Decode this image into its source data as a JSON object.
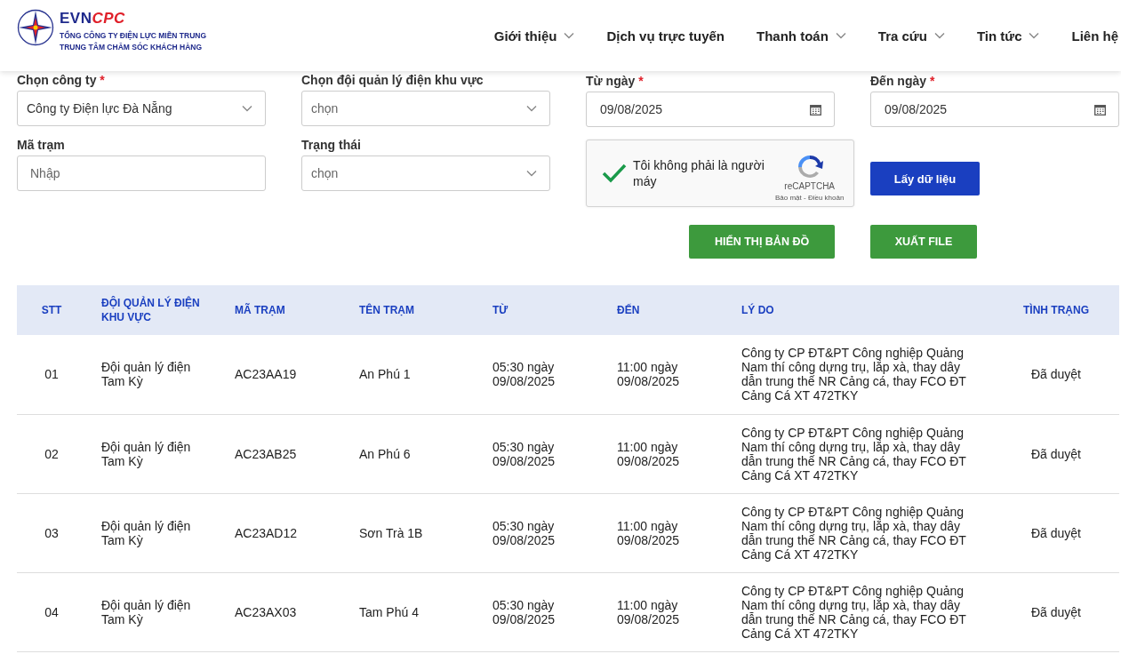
{
  "brand": {
    "logo_main": "EVN",
    "logo_accent": "CPC",
    "line1": "TỔNG CÔNG TY ĐIỆN LỰC MIỀN TRUNG",
    "line2": "TRUNG TÂM CHĂM SÓC KHÁCH HÀNG"
  },
  "nav": [
    {
      "label": "Giới thiệu",
      "dropdown": true
    },
    {
      "label": "Dịch vụ trực tuyến",
      "dropdown": false
    },
    {
      "label": "Thanh toán",
      "dropdown": true
    },
    {
      "label": "Tra cứu",
      "dropdown": true
    },
    {
      "label": "Tin tức",
      "dropdown": true
    },
    {
      "label": "Liên hệ",
      "dropdown": false
    }
  ],
  "required_mark": "*",
  "filters": [
    {
      "kind": "select",
      "label": "Chọn công ty",
      "required": true,
      "value": "Công ty Điện lực Đà Nẵng"
    },
    {
      "kind": "select",
      "label": "Chọn đội quản lý điện khu vực",
      "required": false,
      "placeholder": "chọn"
    },
    {
      "kind": "date",
      "label": "Từ ngày",
      "required": true,
      "value": "09/08/2025"
    },
    {
      "kind": "date",
      "label": "Đến ngày",
      "required": true,
      "value": "09/08/2025"
    },
    {
      "kind": "text",
      "label": "Mã trạm",
      "required": false,
      "placeholder": "Nhập"
    },
    {
      "kind": "select",
      "label": "Trạng thái",
      "required": false,
      "placeholder": "chọn"
    }
  ],
  "captcha": {
    "checked": true,
    "label": "Tôi không phải là người máy",
    "brand": "reCAPTCHA",
    "links": "Bảo mật - Điều khoản"
  },
  "fetch_button": "Lấy dữ liệu",
  "action_buttons": [
    "HIỂN THỊ BẢN ĐỒ",
    "XUẤT FILE"
  ],
  "table": {
    "columns": [
      "STT",
      "ĐỘI QUẢN LÝ ĐIỆN KHU VỰC",
      "MÃ TRẠM",
      "TÊN TRẠM",
      "TỪ",
      "ĐẾN",
      "LÝ DO",
      "TÌNH TRẠNG"
    ],
    "rows": [
      [
        "01",
        "Đội quản lý điện Tam Kỳ",
        "AC23AA19",
        "An Phú 1",
        "05:30 ngày 09/08/2025",
        "11:00 ngày 09/08/2025",
        "Công ty CP ĐT&PT Công nghiệp Quảng Nam thí công dựng trụ, lắp xà, thay dây dẫn trung thế NR Cảng cá, thay FCO ĐT Cảng Cá XT 472TKY",
        "Đã duyệt"
      ],
      [
        "02",
        "Đội quản lý điện Tam Kỳ",
        "AC23AB25",
        "An Phú 6",
        "05:30 ngày 09/08/2025",
        "11:00 ngày 09/08/2025",
        "Công ty CP ĐT&PT Công nghiệp Quảng Nam thí công dựng trụ, lắp xà, thay dây dẫn trung thế NR Cảng cá, thay FCO ĐT Cảng Cá XT 472TKY",
        "Đã duyệt"
      ],
      [
        "03",
        "Đội quản lý điện Tam Kỳ",
        "AC23AD12",
        "Sơn Trà 1B",
        "05:30 ngày 09/08/2025",
        "11:00 ngày 09/08/2025",
        "Công ty CP ĐT&PT Công nghiệp Quảng Nam thí công dựng trụ, lắp xà, thay dây dẫn trung thế NR Cảng cá, thay FCO ĐT Cảng Cá XT 472TKY",
        "Đã duyệt"
      ],
      [
        "04",
        "Đội quản lý điện Tam Kỳ",
        "AC23AX03",
        "Tam Phú 4",
        "05:30 ngày 09/08/2025",
        "11:00 ngày 09/08/2025",
        "Công ty CP ĐT&PT Công nghiệp Quảng Nam thí công dựng trụ, lắp xà, thay dây dẫn trung thế NR Cảng cá, thay FCO ĐT Cảng Cá XT 472TKY",
        "Đã duyệt"
      ]
    ]
  }
}
